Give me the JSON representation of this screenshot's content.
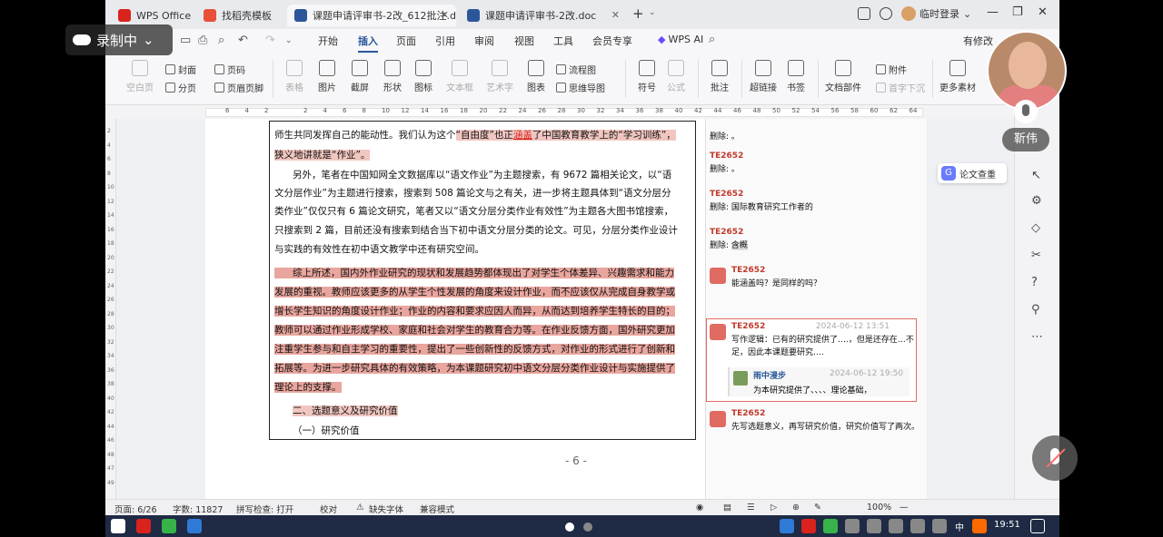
{
  "tabs": [
    {
      "label": "WPS Office",
      "color": "#d9231c",
      "active": false
    },
    {
      "label": "找稻壳模板",
      "color": "#e8503a",
      "active": false
    },
    {
      "label": "课题申请评审书-2改_612批注.doc",
      "color": "#2b579a",
      "active": true
    },
    {
      "label": "课题申请评审书-2改.doc",
      "color": "#2b579a",
      "active": false
    }
  ],
  "titlebar": {
    "login_label": "临时登录"
  },
  "quick_access": {
    "undo": "↶",
    "redo": "↷"
  },
  "menu": [
    "开始",
    "插入",
    "页面",
    "引用",
    "审阅",
    "视图",
    "工具",
    "会员专享"
  ],
  "menu_active": "插入",
  "wps_ai": "WPS AI",
  "modify_label": "有修改",
  "ribbon": {
    "blank_page": "空白页",
    "cover": "封面",
    "section_break": "分页",
    "page_number": "页码",
    "header_footer": "页眉页脚",
    "table": "表格",
    "picture": "图片",
    "screenshot": "截屏",
    "shape": "形状",
    "icon": "图标",
    "textbox": "文本框",
    "art_text": "艺术字",
    "chart": "图表",
    "flowchart": "流程图",
    "mindmap": "思维导图",
    "symbol": "符号",
    "formula": "公式",
    "comment": "批注",
    "hyperlink": "超链接",
    "bookmark": "书签",
    "doc_parts": "文档部件",
    "attachment": "附件",
    "dropcap": "首字下沉",
    "more": "更多素材"
  },
  "ruler": [
    "6",
    "4",
    "2",
    "",
    "2",
    "4",
    "6",
    "8",
    "10",
    "12",
    "14",
    "16",
    "18",
    "20",
    "22",
    "24",
    "26",
    "28",
    "30",
    "32",
    "34",
    "36",
    "38",
    "40",
    "42",
    "44",
    "46",
    "48",
    "50",
    "52",
    "54",
    "56",
    "58",
    "60",
    "62",
    "64"
  ],
  "vruler": [
    "2",
    "4",
    "6",
    "8",
    "10",
    "12",
    "14",
    "16",
    "18",
    "20",
    "22",
    "24",
    "26",
    "28",
    "30",
    "32",
    "34",
    "36",
    "38",
    "40",
    "42",
    "44",
    "46",
    "48",
    "47",
    "49"
  ],
  "document": {
    "l1a": "师生共同发挥自己的能动性。我们认为这个",
    "l1b": "“自由度”也正",
    "l1c": "涵盖",
    "l1d": "了中国教育教学上的“学习训练”，",
    "l2": "狭义地讲就是“作业”。",
    "l3": "另外，笔者在中国知网全文数据库以“语文作业”为主题搜索，有 9672 篇相关论文，以“语",
    "l4": "文分层作业”为主题进行搜索，搜索到 508 篇论文与之有关，进一步将主题具体到“语文分层分",
    "l5": "类作业”仅仅只有 6 篇论文研究，笔者又以“语文分层分类作业有效性”为主题各大图书馆搜索，",
    "l6": "只搜索到 2 篇，目前还没有搜索到结合当下初中语文分层分类的论文。可见，分层分类作业设计",
    "l7": "与实践的有效性在初中语文教学中还有研究空间。",
    "l8": "综上所述，国内外作业研究的现状和发展趋势都体现出了对学生个体差异、兴趣需求和能力",
    "l9": "发展的重视。教师应该更多的从学生个性发展的角度来设计作业，而不应该仅从完成自身教学或",
    "l10": "增长学生知识的角度设计作业；作业的内容和要求应因人而异，从而达到培养学生特长的目的；",
    "l11": "教师可以通过作业形成学校、家庭和社会对学生的教育合力等。在作业反馈方面，国外研究更加",
    "l12": "注重学生参与和自主学习的重要性，提出了一些创新性的反馈方式，对作业的形式进行了创新和",
    "l13": "拓展等。为进一步研究具体的有效策略，为本课题研究初中语文分层分类作业设计与实施提供了",
    "l14": "理论上的支撑。",
    "l15": "二、选题意义及研究价值",
    "l16": "（一）研究价值",
    "page_number": "- 6 -"
  },
  "comments": [
    {
      "label": "删除: ",
      "value": "。"
    },
    {
      "author": "TE2652",
      "label": "删除: ",
      "value": "。"
    },
    {
      "author": "TE2652",
      "label": "删除: ",
      "value": "国际教育研究工作者的"
    },
    {
      "author": "TE2652",
      "label": "删除: ",
      "value": "含概"
    },
    {
      "author": "TE2652",
      "body": "能涵盖吗？是同样的吗？"
    },
    {
      "author": "TE2652",
      "time": "2024-06-12 13:51",
      "body": "写作逻辑：已有的研究提供了….，但是还存在…不足，因此本课题要研究…."
    },
    {
      "author": "雨中漫步",
      "time": "2024-06-12 19:50",
      "body": "为本研究提供了、、、、理论基础，"
    },
    {
      "author": "TE2652",
      "body": "先写选题意义，再写研究价值，研究价值写了两次。"
    }
  ],
  "side_panel": {
    "paper_check": "论文查重"
  },
  "status": {
    "page": "页面: 6/26",
    "words": "字数: 11827",
    "spell": "拼写检查: 打开",
    "proof": "校对",
    "missing_font": "缺失字体",
    "compat": "兼容模式",
    "zoom": "100%"
  },
  "overlay": {
    "recording": "录制中",
    "name": "靳伟"
  },
  "taskbar": {
    "time": "19:51",
    "ime": "中"
  }
}
